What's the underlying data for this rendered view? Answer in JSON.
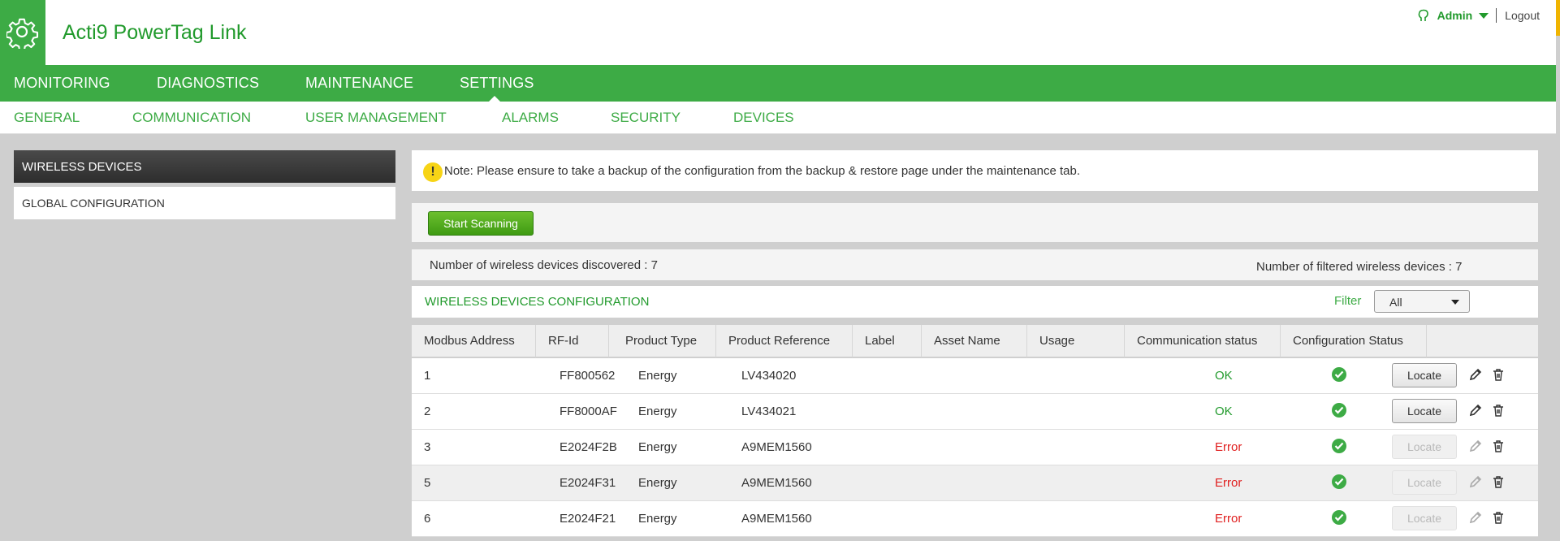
{
  "header": {
    "title": "Acti9 PowerTag Link",
    "logo_icon": "gear-icon",
    "user": "Admin",
    "logout": "Logout"
  },
  "main_nav": [
    {
      "label": "MONITORING"
    },
    {
      "label": "DIAGNOSTICS"
    },
    {
      "label": "MAINTENANCE"
    },
    {
      "label": "SETTINGS",
      "active": true
    }
  ],
  "sub_nav": [
    {
      "label": "GENERAL"
    },
    {
      "label": "COMMUNICATION"
    },
    {
      "label": "USER MANAGEMENT"
    },
    {
      "label": "ALARMS"
    },
    {
      "label": "SECURITY"
    },
    {
      "label": "DEVICES",
      "active": true
    }
  ],
  "sidebar": {
    "items": [
      {
        "label": "WIRELESS DEVICES",
        "active": true
      },
      {
        "label": "GLOBAL CONFIGURATION"
      }
    ]
  },
  "note": {
    "icon": "!",
    "text": "Note: Please ensure to take a backup of the configuration from the backup & restore page under the maintenance tab."
  },
  "scan": {
    "button": "Start Scanning"
  },
  "counts": {
    "discovered": "Number of wireless devices discovered : 7",
    "filtered": "Number of filtered wireless devices : 7"
  },
  "config": {
    "title": "WIRELESS DEVICES CONFIGURATION",
    "filter_label": "Filter",
    "filter_value": "All"
  },
  "table": {
    "columns": [
      "Modbus Address",
      "RF-Id",
      "Product Type",
      "Product Reference",
      "Label",
      "Asset Name",
      "Usage",
      "Communication status",
      "Configuration Status"
    ],
    "locate_label": "Locate",
    "rows": [
      {
        "address": "1",
        "rfid": "FF800562",
        "type": "Energy",
        "reference": "LV434020",
        "label": "",
        "asset": "",
        "usage": "",
        "comm": "OK",
        "config": "check-icon",
        "locate_enabled": true
      },
      {
        "address": "2",
        "rfid": "FF8000AF",
        "type": "Energy",
        "reference": "LV434021",
        "label": "",
        "asset": "",
        "usage": "",
        "comm": "OK",
        "config": "check-icon",
        "locate_enabled": true
      },
      {
        "address": "3",
        "rfid": "E2024F2B",
        "type": "Energy",
        "reference": "A9MEM1560",
        "label": "",
        "asset": "",
        "usage": "",
        "comm": "Error",
        "config": "check-icon",
        "locate_enabled": false
      },
      {
        "address": "5",
        "rfid": "E2024F31",
        "type": "Energy",
        "reference": "A9MEM1560",
        "label": "",
        "asset": "",
        "usage": "",
        "comm": "Error",
        "config": "check-icon",
        "locate_enabled": false
      },
      {
        "address": "6",
        "rfid": "E2024F21",
        "type": "Energy",
        "reference": "A9MEM1560",
        "label": "",
        "asset": "",
        "usage": "",
        "comm": "Error",
        "config": "check-icon",
        "locate_enabled": false
      }
    ]
  },
  "colors": {
    "brand_green": "#3dab45",
    "dark_green": "#219a2c",
    "error_red": "#e01e1e",
    "warning_yellow": "#f7d416"
  }
}
